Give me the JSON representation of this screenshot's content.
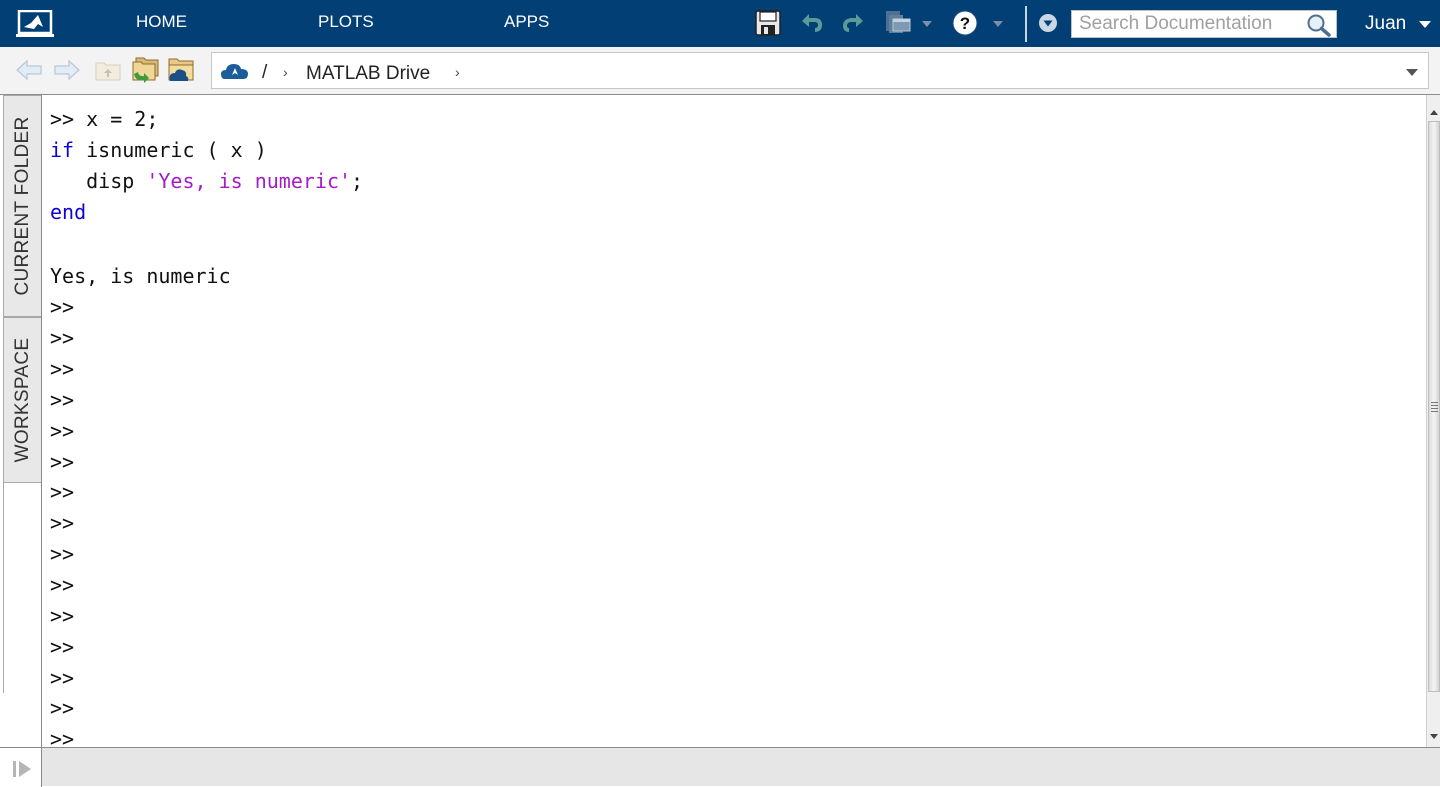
{
  "toolstrip": {
    "tabs": [
      {
        "label": "HOME"
      },
      {
        "label": "PLOTS"
      },
      {
        "label": "APPS"
      }
    ],
    "quick_access": {
      "icons": [
        "save-icon",
        "undo-icon",
        "redo-icon",
        "switch-windows-icon",
        "help-icon"
      ]
    },
    "search": {
      "placeholder": "Search Documentation",
      "value": ""
    },
    "user": "Juan",
    "colors": {
      "bar_bg": "#023f75",
      "undo_redo": "#5a9a98"
    }
  },
  "address_bar": {
    "path": [
      {
        "label": "/"
      },
      {
        "label": "MATLAB Drive"
      }
    ]
  },
  "side_tabs": [
    {
      "label": "CURRENT FOLDER"
    },
    {
      "label": "WORKSPACE"
    }
  ],
  "command_window": {
    "lines": [
      {
        "prompt": ">> ",
        "code": "x = 2;"
      },
      {
        "keyword": "if",
        "rest": " isnumeric ( x )"
      },
      {
        "indent": "   disp ",
        "string": "'Yes, is numeric'",
        "tail": ";"
      },
      {
        "keyword": "end"
      },
      {
        "output": "Yes, is numeric"
      }
    ],
    "prompts": [
      ">>",
      ">>",
      ">>",
      ">>",
      ">>",
      ">>",
      ">>",
      ">>",
      ">>",
      ">>",
      ">>",
      ">>",
      ">>",
      ">>",
      ">>"
    ],
    "colors": {
      "keyword": "#0e00d8",
      "string": "#a51bc9"
    }
  }
}
